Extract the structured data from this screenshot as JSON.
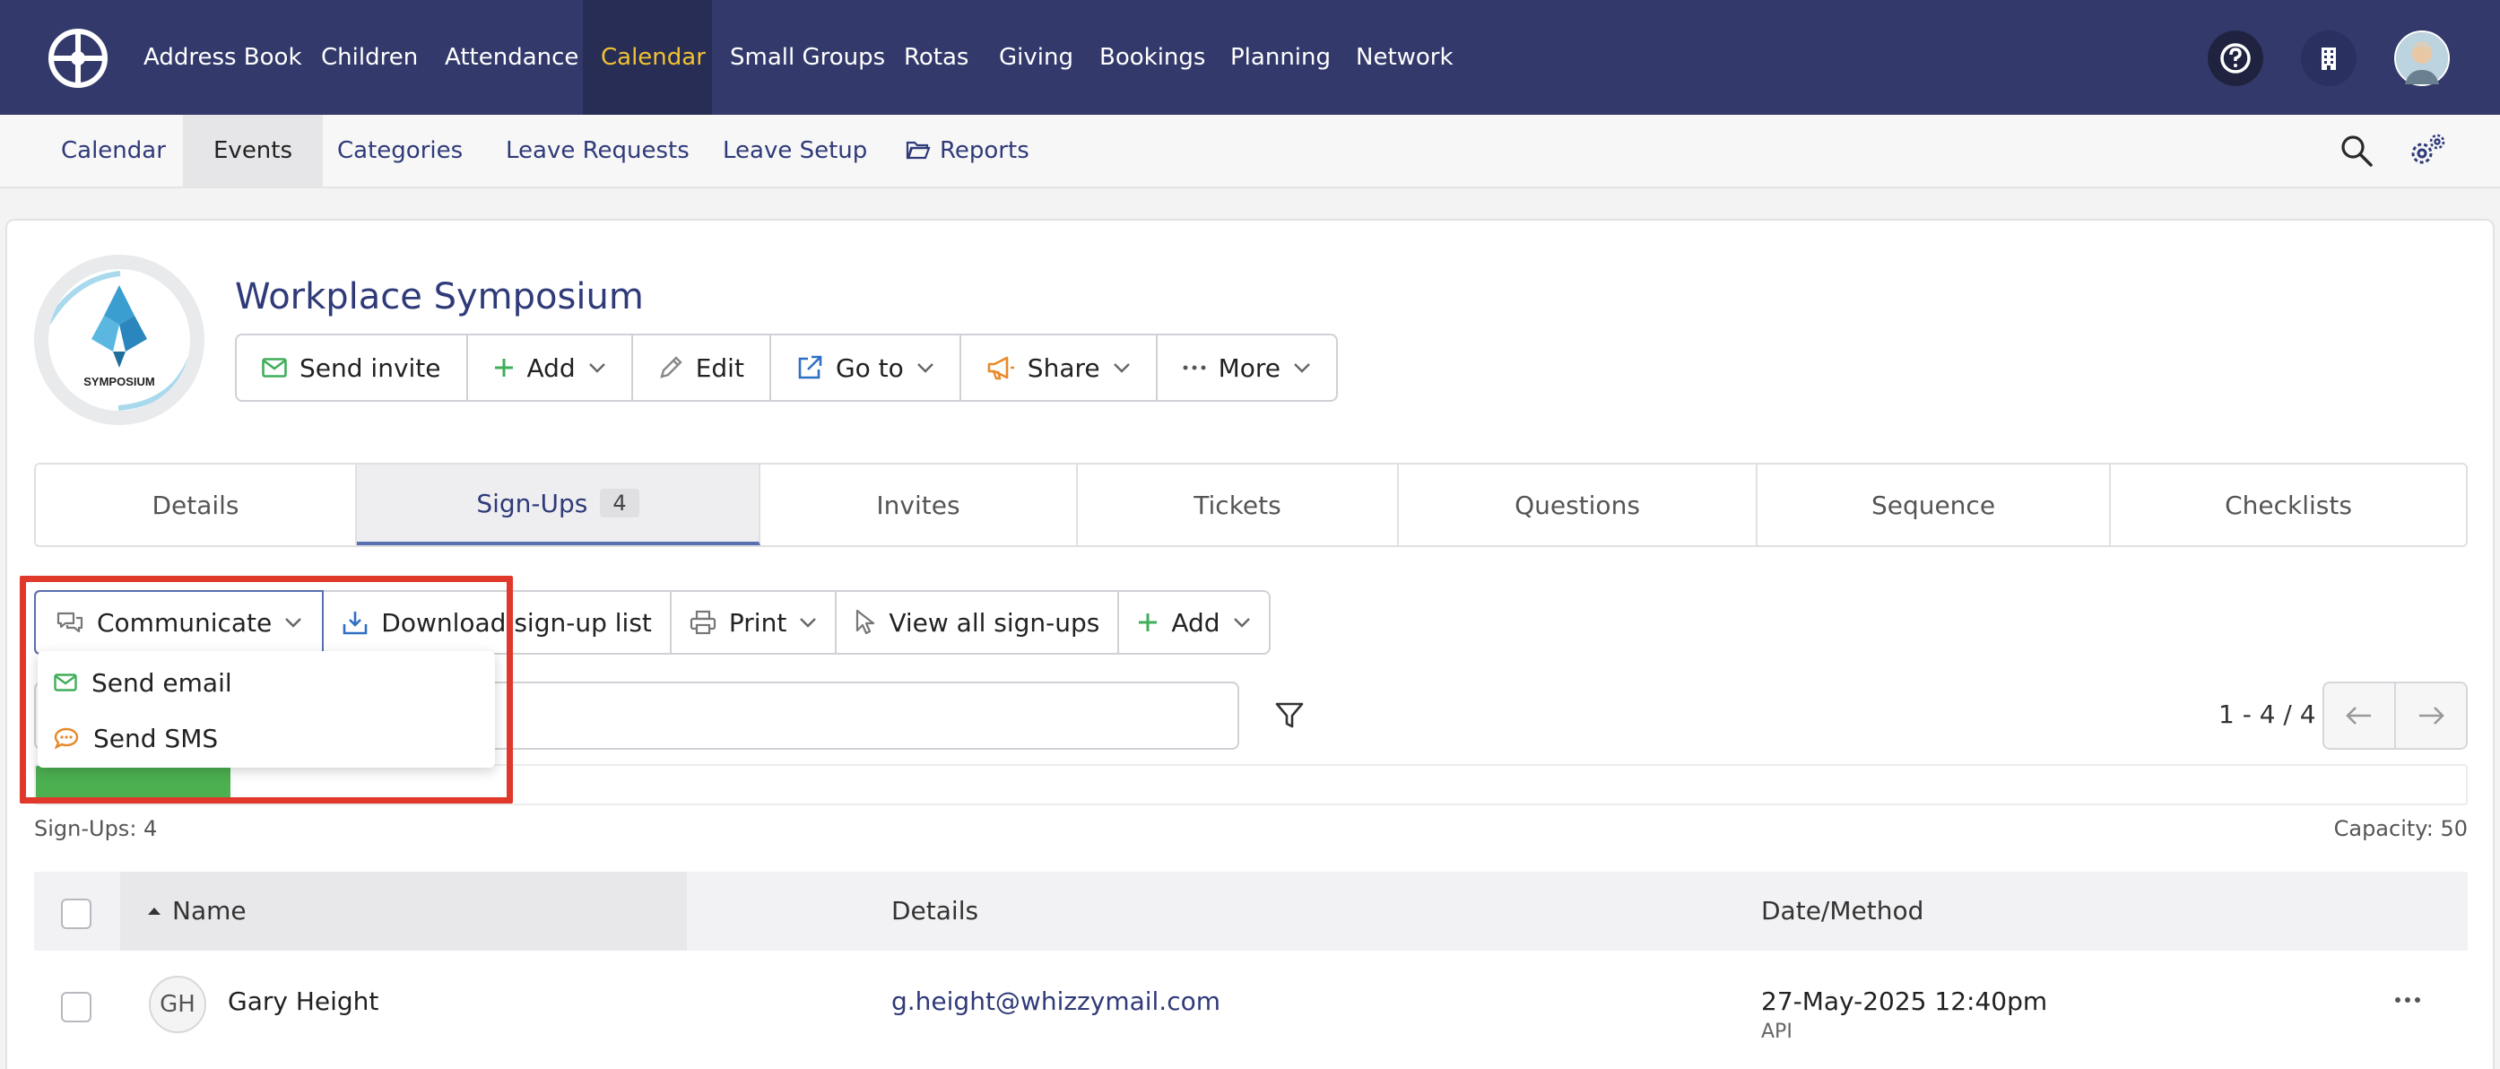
{
  "topnav": {
    "items": [
      "Address Book",
      "Children",
      "Attendance",
      "Calendar",
      "Small Groups",
      "Rotas",
      "Giving",
      "Bookings",
      "Planning",
      "Network"
    ],
    "active": "Calendar"
  },
  "subnav": {
    "items": [
      "Calendar",
      "Events",
      "Categories",
      "Leave Requests",
      "Leave Setup",
      "Reports"
    ],
    "active": "Events"
  },
  "event": {
    "logo_text": "SYMPOSIUM",
    "title": "Workplace Symposium"
  },
  "actions": {
    "send_invite": "Send invite",
    "add": "Add",
    "edit": "Edit",
    "goto": "Go to",
    "share": "Share",
    "more": "More"
  },
  "tabs": {
    "details": "Details",
    "signups": "Sign-Ups",
    "signups_count": "4",
    "invites": "Invites",
    "tickets": "Tickets",
    "questions": "Questions",
    "sequence": "Sequence",
    "checklists": "Checklists"
  },
  "toolbar": {
    "communicate": "Communicate",
    "download": "Download sign-up list",
    "print": "Print",
    "view_all": "View all sign-ups",
    "add": "Add"
  },
  "dropdown": {
    "send_email": "Send email",
    "send_sms": "Send SMS"
  },
  "pagination": {
    "range": "1 - 4 / 4"
  },
  "capacity": {
    "signups_label": "Sign-Ups: 4",
    "capacity_label": "Capacity: 50",
    "fill_fraction": 0.08
  },
  "table": {
    "headers": {
      "name": "Name",
      "details": "Details",
      "date": "Date/Method"
    },
    "rows": [
      {
        "initials": "GH",
        "name": "Gary Height",
        "email": "g.height@whizzymail.com",
        "date": "27-May-2025 12:40pm",
        "method": "API"
      }
    ]
  },
  "colors": {
    "nav_bg": "#333a6b",
    "accent_active": "#f2c230",
    "link": "#2f3a78",
    "progress": "#4caf50",
    "highlight": "#e0392b"
  }
}
